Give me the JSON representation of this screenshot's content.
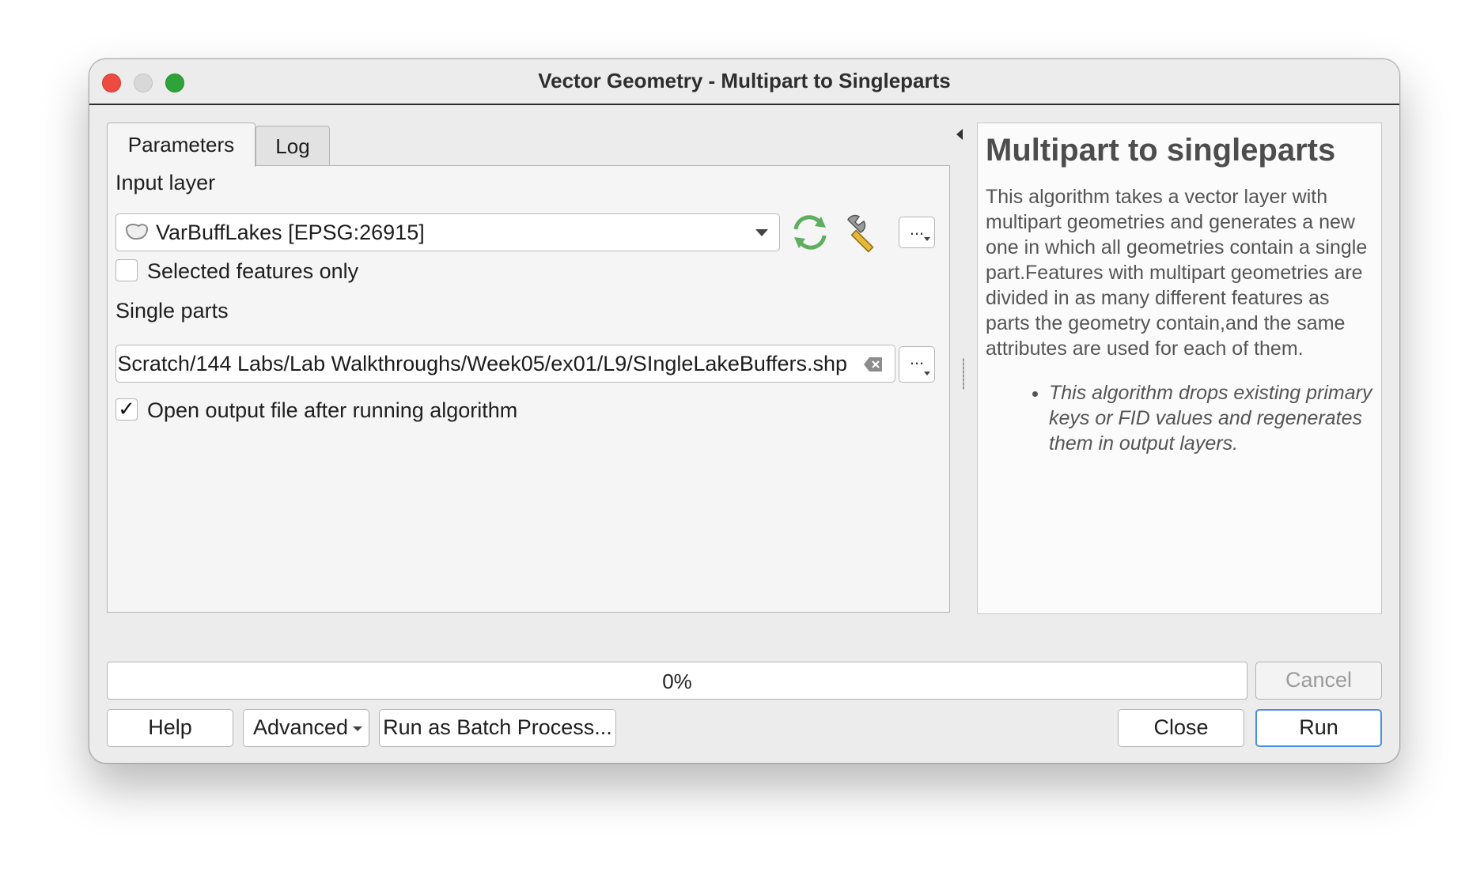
{
  "window": {
    "title": "Vector Geometry - Multipart to Singleparts"
  },
  "tabs": {
    "parameters": "Parameters",
    "log": "Log"
  },
  "form": {
    "input_layer_label": "Input layer",
    "input_layer_value": "VarBuffLakes [EPSG:26915]",
    "selected_only_label": "Selected features only",
    "selected_only_checked": false,
    "single_parts_label": "Single parts",
    "single_parts_value": "Scratch/144 Labs/Lab Walkthroughs/Week05/ex01/L9/SIngleLakeBuffers.shp",
    "open_output_label": "Open output file after running algorithm",
    "open_output_checked": true,
    "open_output_mark": "✓",
    "more_options_label": "..."
  },
  "help": {
    "heading": "Multipart to singleparts",
    "description": "This algorithm takes a vector layer with multipart geometries and generates a new one in which all geometries contain a single part.Features with multipart geometries are divided in as many different features as parts the geometry contain,and the same attributes are used for each of them.",
    "notes": [
      "This algorithm drops existing primary keys or FID values and regenerates them in output layers."
    ]
  },
  "progress": {
    "text": "0%",
    "value": 0
  },
  "buttons": {
    "cancel": "Cancel",
    "help": "Help",
    "advanced": "Advanced",
    "batch": "Run as Batch Process...",
    "close": "Close",
    "run": "Run"
  },
  "colors": {
    "accent": "#4a90e2",
    "refresh_icon": "#5fae5f",
    "close_button": "#ee4a3f",
    "zoom_button": "#2fa33a"
  }
}
